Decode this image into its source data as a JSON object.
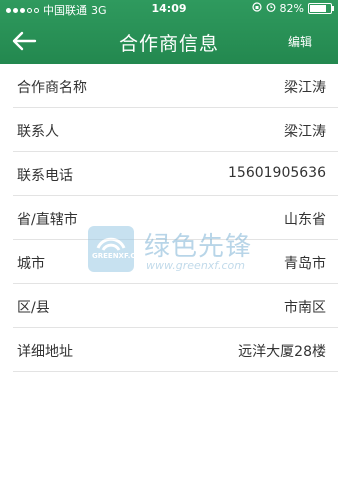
{
  "status": {
    "carrier": "中国联通",
    "network": "3G",
    "time": "14:09",
    "battery_percent": "82%",
    "battery_level": 0.82
  },
  "header": {
    "title": "合作商信息",
    "edit_label": "编辑"
  },
  "fields": [
    {
      "label": "合作商名称",
      "value": "梁江涛"
    },
    {
      "label": "联系人",
      "value": "梁江涛"
    },
    {
      "label": "联系电话",
      "value": "15601905636"
    },
    {
      "label": "省/直辖市",
      "value": "山东省"
    },
    {
      "label": "城市",
      "value": "青岛市"
    },
    {
      "label": "区/县",
      "value": "市南区"
    },
    {
      "label": "详细地址",
      "value": "远洋大厦28楼"
    }
  ],
  "watermark": {
    "logo_text": "GREENXF.COM",
    "name": "绿色先锋",
    "url": "www.greenxf.com"
  },
  "colors": {
    "header": "#2a9257",
    "divider": "#e3e3e3",
    "text": "#333333"
  }
}
